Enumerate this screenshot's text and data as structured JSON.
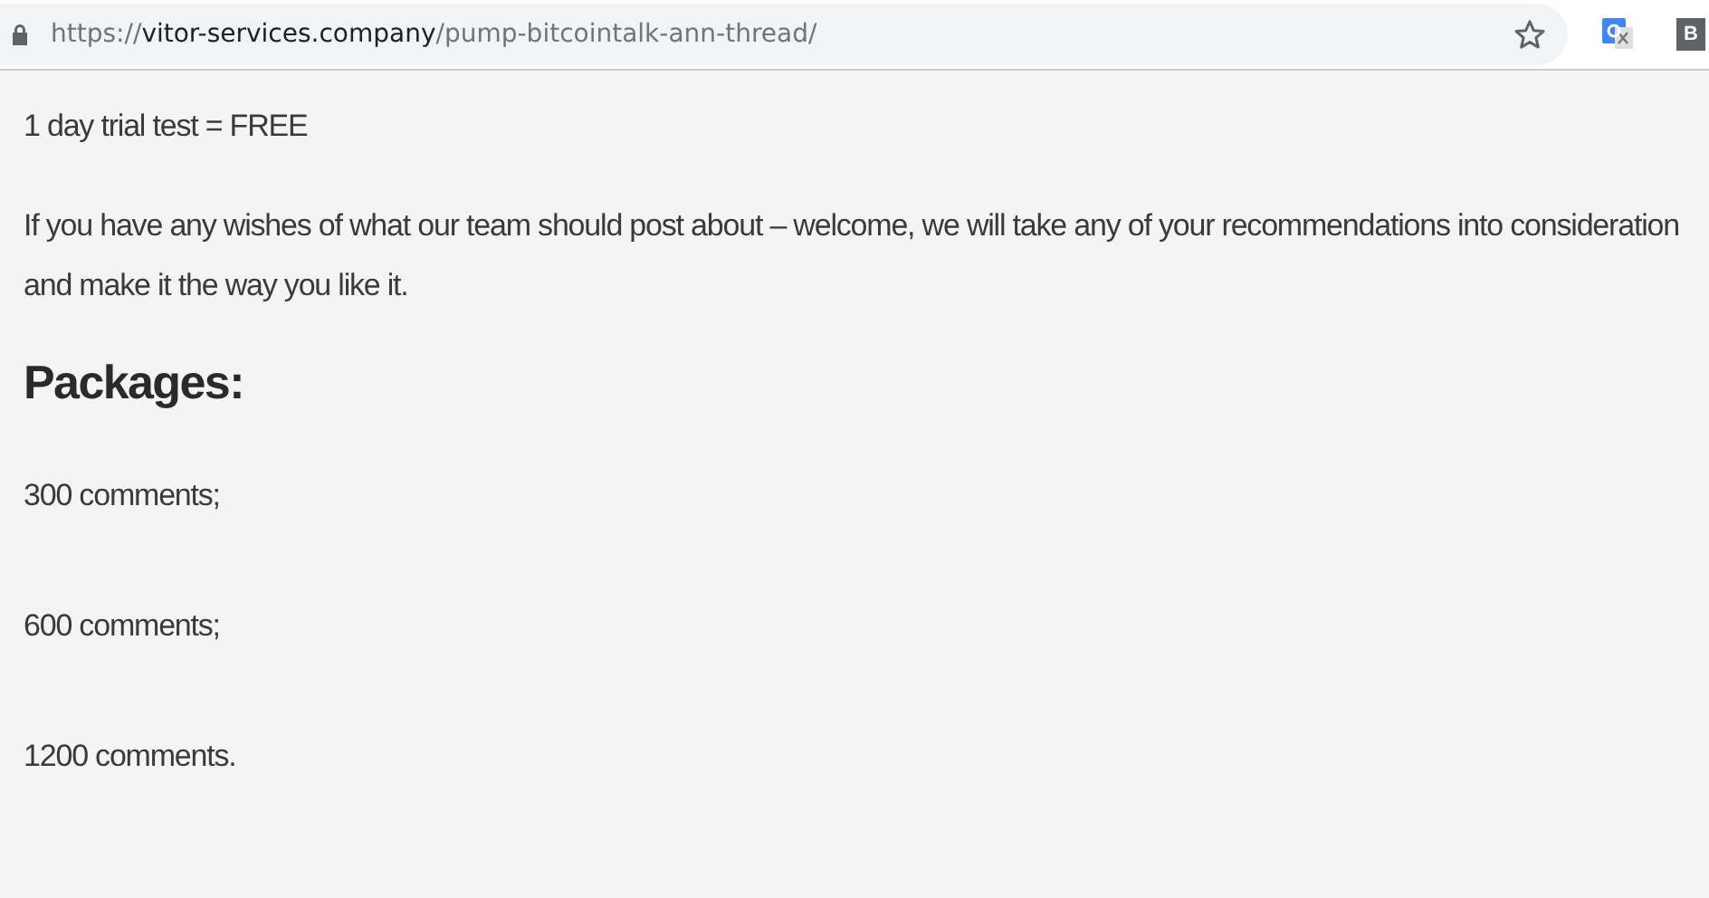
{
  "address_bar": {
    "scheme": "https://",
    "host": "vitor-services.company",
    "path": "/pump-bitcointalk-ann-thread/"
  },
  "extension_label": "B",
  "content": [
    {
      "kind": "paragraph",
      "text": "1 day trial test = FREE"
    },
    {
      "kind": "paragraph",
      "text": "If you have any wishes of what our team should post about – welcome, we will take any of your recommendations into consideration and make it the way you like it."
    },
    {
      "kind": "heading",
      "text": "Packages:"
    },
    {
      "kind": "item",
      "text": "300 comments;"
    },
    {
      "kind": "item",
      "text": "600 comments;"
    },
    {
      "kind": "item",
      "text": "1200 comments."
    }
  ]
}
